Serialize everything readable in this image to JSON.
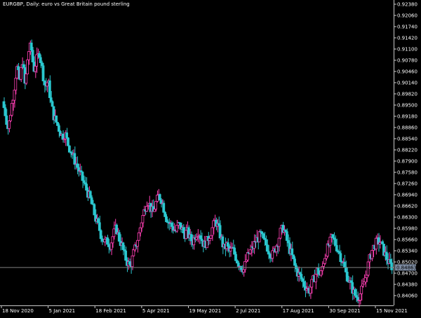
{
  "window": {
    "symbol": "EURGBP,",
    "timeframe": "Daily:",
    "description": "euro vs Great Britain pound sterling"
  },
  "colors": {
    "background": "#000000",
    "axis": "#c8c8c8",
    "text": "#ffffff",
    "bull": "#ff3fb4",
    "bear": "#2bc7cf",
    "price_line": "#808080",
    "price_label_bg": "#7c8aa0"
  },
  "current_price_label": "0.84863",
  "chart_data": {
    "type": "candlestick",
    "y_axis_labels": [
      "0.92380",
      "0.92060",
      "0.91740",
      "0.91420",
      "0.91100",
      "0.90780",
      "0.90460",
      "0.90140",
      "0.89820",
      "0.89500",
      "0.89180",
      "0.88860",
      "0.88540",
      "0.88220",
      "0.87900",
      "0.87580",
      "0.87260",
      "0.86940",
      "0.86620",
      "0.86300",
      "0.85980",
      "0.85660",
      "0.85340",
      "0.85020",
      "0.84700",
      "0.84380",
      "0.84060"
    ],
    "ylim": [
      0.84,
      0.924
    ],
    "current_price": 0.84863,
    "x_axis_labels": [
      "18 Nov 2020",
      "5 Jan 2021",
      "18 Feb 2021",
      "5 Apr 2021",
      "19 May 2021",
      "2 Jul 2021",
      "17 Aug 2021",
      "30 Sep 2021",
      "15 Nov 2021"
    ],
    "close_path": [
      0.896,
      0.8925,
      0.888,
      0.894,
      0.899,
      0.906,
      0.902,
      0.908,
      0.9,
      0.91,
      0.912,
      0.905,
      0.908,
      0.91,
      0.905,
      0.9,
      0.902,
      0.896,
      0.892,
      0.89,
      0.888,
      0.886,
      0.887,
      0.884,
      0.882,
      0.88,
      0.878,
      0.876,
      0.874,
      0.872,
      0.87,
      0.868,
      0.865,
      0.862,
      0.86,
      0.857,
      0.856,
      0.856,
      0.855,
      0.858,
      0.86,
      0.857,
      0.855,
      0.852,
      0.85,
      0.849,
      0.852,
      0.855,
      0.858,
      0.862,
      0.865,
      0.868,
      0.866,
      0.864,
      0.867,
      0.869,
      0.868,
      0.865,
      0.862,
      0.861,
      0.86,
      0.859,
      0.861,
      0.86,
      0.858,
      0.859,
      0.857,
      0.856,
      0.858,
      0.859,
      0.857,
      0.855,
      0.856,
      0.858,
      0.86,
      0.862,
      0.86,
      0.857,
      0.854,
      0.855,
      0.853,
      0.854,
      0.852,
      0.85,
      0.849,
      0.848,
      0.851,
      0.853,
      0.854,
      0.856,
      0.857,
      0.858,
      0.856,
      0.855,
      0.853,
      0.852,
      0.854,
      0.856,
      0.859,
      0.86,
      0.857,
      0.854,
      0.852,
      0.849,
      0.847,
      0.846,
      0.844,
      0.843,
      0.842,
      0.844,
      0.846,
      0.848,
      0.846,
      0.85,
      0.853,
      0.855,
      0.857,
      0.856,
      0.854,
      0.852,
      0.85,
      0.847,
      0.845,
      0.843,
      0.841,
      0.84,
      0.841,
      0.843,
      0.846,
      0.85,
      0.853,
      0.855,
      0.856,
      0.856,
      0.854,
      0.852,
      0.85,
      0.849,
      0.8486
    ]
  }
}
